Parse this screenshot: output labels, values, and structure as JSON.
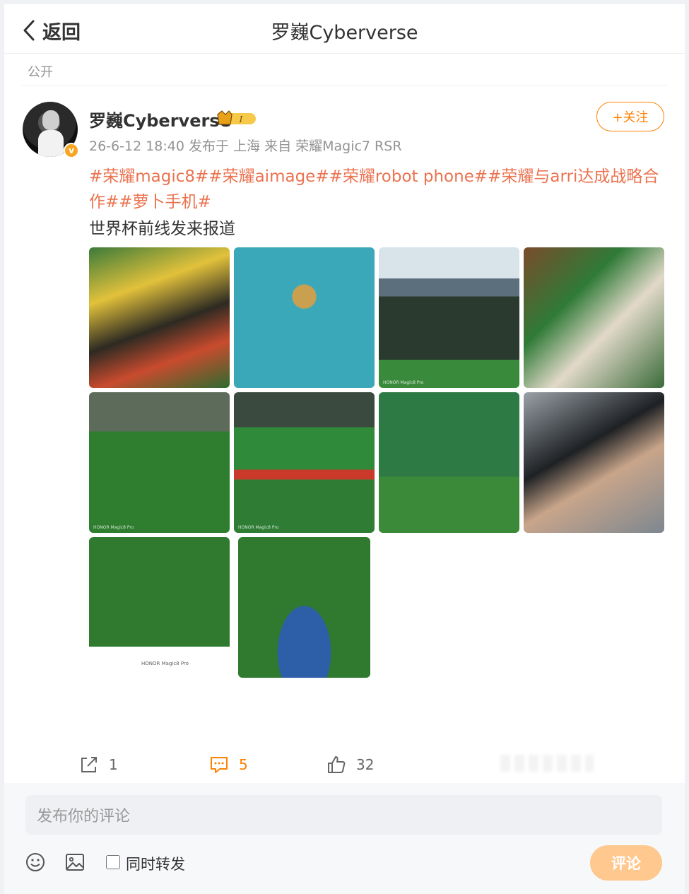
{
  "header": {
    "back_label": "返回",
    "title": "罗巍Cyberverse"
  },
  "post": {
    "visibility": "公开",
    "author": "罗巍Cyberverse",
    "level_badge": "I",
    "follow_label": "+关注",
    "meta": "26-6-12 18:40  发布于 上海  来自 荣耀Magic7 RSR",
    "hashtags": "#荣耀magic8##荣耀aimage##荣耀robot phone##荣耀与arri达成战略合作##萝卜手机#",
    "text": "世界杯前线发来报道",
    "images": [
      {
        "name": "fans-in-stands",
        "caption": ""
      },
      {
        "name": "opening-ceremony-globe",
        "caption": ""
      },
      {
        "name": "stadium-big-screen",
        "caption": "HONOR Magic8 Pro"
      },
      {
        "name": "fans-selfie",
        "caption": ""
      },
      {
        "name": "pitch-match-view",
        "caption": "HONOR Magic8 Pro"
      },
      {
        "name": "flags-on-pitch",
        "caption": "HONOR Magic8 Pro"
      },
      {
        "name": "rexona-booth",
        "caption": ""
      },
      {
        "name": "mexico-fan",
        "caption": ""
      },
      {
        "name": "players-on-pitch",
        "caption": "HONOR Magic8 Pro"
      },
      {
        "name": "world-cup-2026-lineup",
        "caption": ""
      }
    ]
  },
  "actions": {
    "share_count": "1",
    "comment_count": "5",
    "like_count": "32"
  },
  "composer": {
    "placeholder": "发布你的评论",
    "repost_label": "同时转发",
    "submit_label": "评论"
  },
  "colors": {
    "accent": "#ff8200",
    "hashtag": "#eb7350",
    "submit_disabled": "#ffc88f"
  }
}
